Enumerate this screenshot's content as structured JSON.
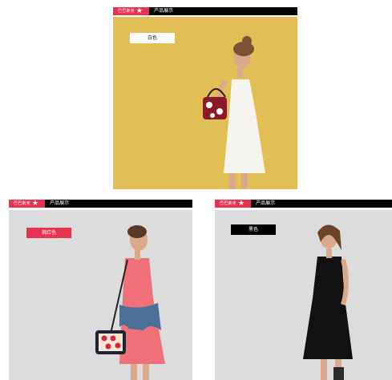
{
  "cards": [
    {
      "brand": "巴巴斯克",
      "header_title": "产品展示",
      "color_tag": "白色"
    },
    {
      "brand": "巴巴斯克",
      "header_title": "产品展示",
      "color_tag": "桃红色"
    },
    {
      "brand": "巴巴斯克",
      "header_title": "产品展示",
      "color_tag": "黑色"
    }
  ],
  "colors": {
    "brand_red": "#e6334f",
    "header_black": "#050505",
    "bg_yellow": "#e2bf55",
    "bg_grey": "#dcdcdc",
    "dress_white": "#f6f4ee",
    "dress_coral": "#f0707a",
    "dress_black": "#111111",
    "tag_white": "#ffffff",
    "tag_red": "#e6334f",
    "tag_black": "#000000"
  }
}
